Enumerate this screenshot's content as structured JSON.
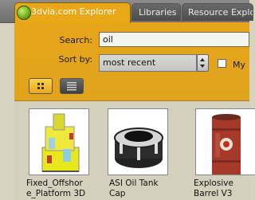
{
  "tabs": [
    {
      "label": "3dvia.com Explorer",
      "active": true
    },
    {
      "label": "Libraries",
      "active": false
    },
    {
      "label": "Resource Explo",
      "active": false
    }
  ],
  "search": {
    "label": "Search:",
    "value": "oil"
  },
  "sort": {
    "label": "Sort by:",
    "value": "most recent",
    "checkbox_label": "My"
  },
  "view": {
    "grid_icon": "grid-view-icon",
    "list_icon": "list-view-icon"
  },
  "results": [
    {
      "name": "Fixed_Offshor\ne_Platform 3D",
      "icon": "oil-platform-thumbnail"
    },
    {
      "name": "ASI Oil Tank\nCap",
      "icon": "oil-tank-cap-thumbnail"
    },
    {
      "name": "Explosive\nBarrel V3",
      "icon": "explosive-barrel-thumbnail"
    }
  ],
  "colors": {
    "accent": "#e8a817",
    "panel": "#dba21e",
    "tabbar": "#6e6e6e"
  }
}
